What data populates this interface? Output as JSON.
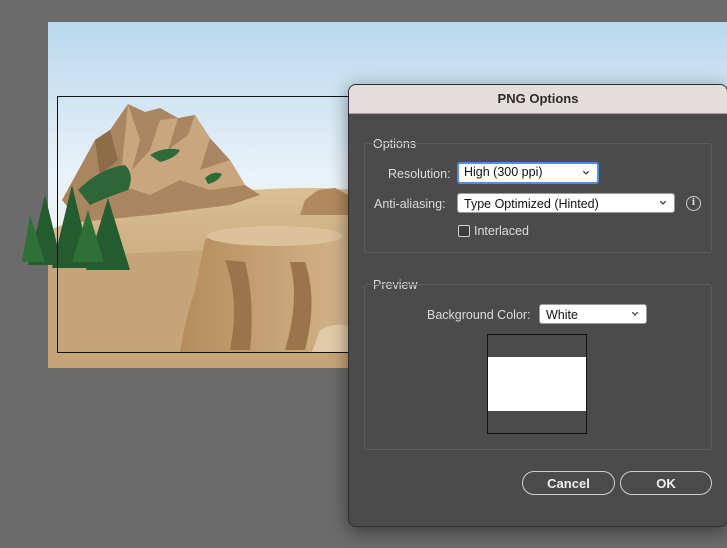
{
  "dialog": {
    "title": "PNG Options",
    "options_group": {
      "title": "Options",
      "resolution_label": "Resolution:",
      "resolution_value": "High (300 ppi)",
      "antialiasing_label": "Anti-aliasing:",
      "antialiasing_value": "Type Optimized (Hinted)",
      "interlaced_label": "Interlaced",
      "interlaced_checked": false
    },
    "preview_group": {
      "title": "Preview",
      "bg_color_label": "Background Color:",
      "bg_color_value": "White"
    },
    "cancel_label": "Cancel",
    "ok_label": "OK"
  },
  "colors": {
    "canvas_bg": "#6b6b6b",
    "dialog_bg": "#4b4b4b",
    "titlebar_bg": "#e5dcdc",
    "focus_ring": "#4d8fe8"
  },
  "icons": {
    "info": "info-icon",
    "chevron": "chevron-down-icon",
    "checkbox": "checkbox-icon"
  }
}
